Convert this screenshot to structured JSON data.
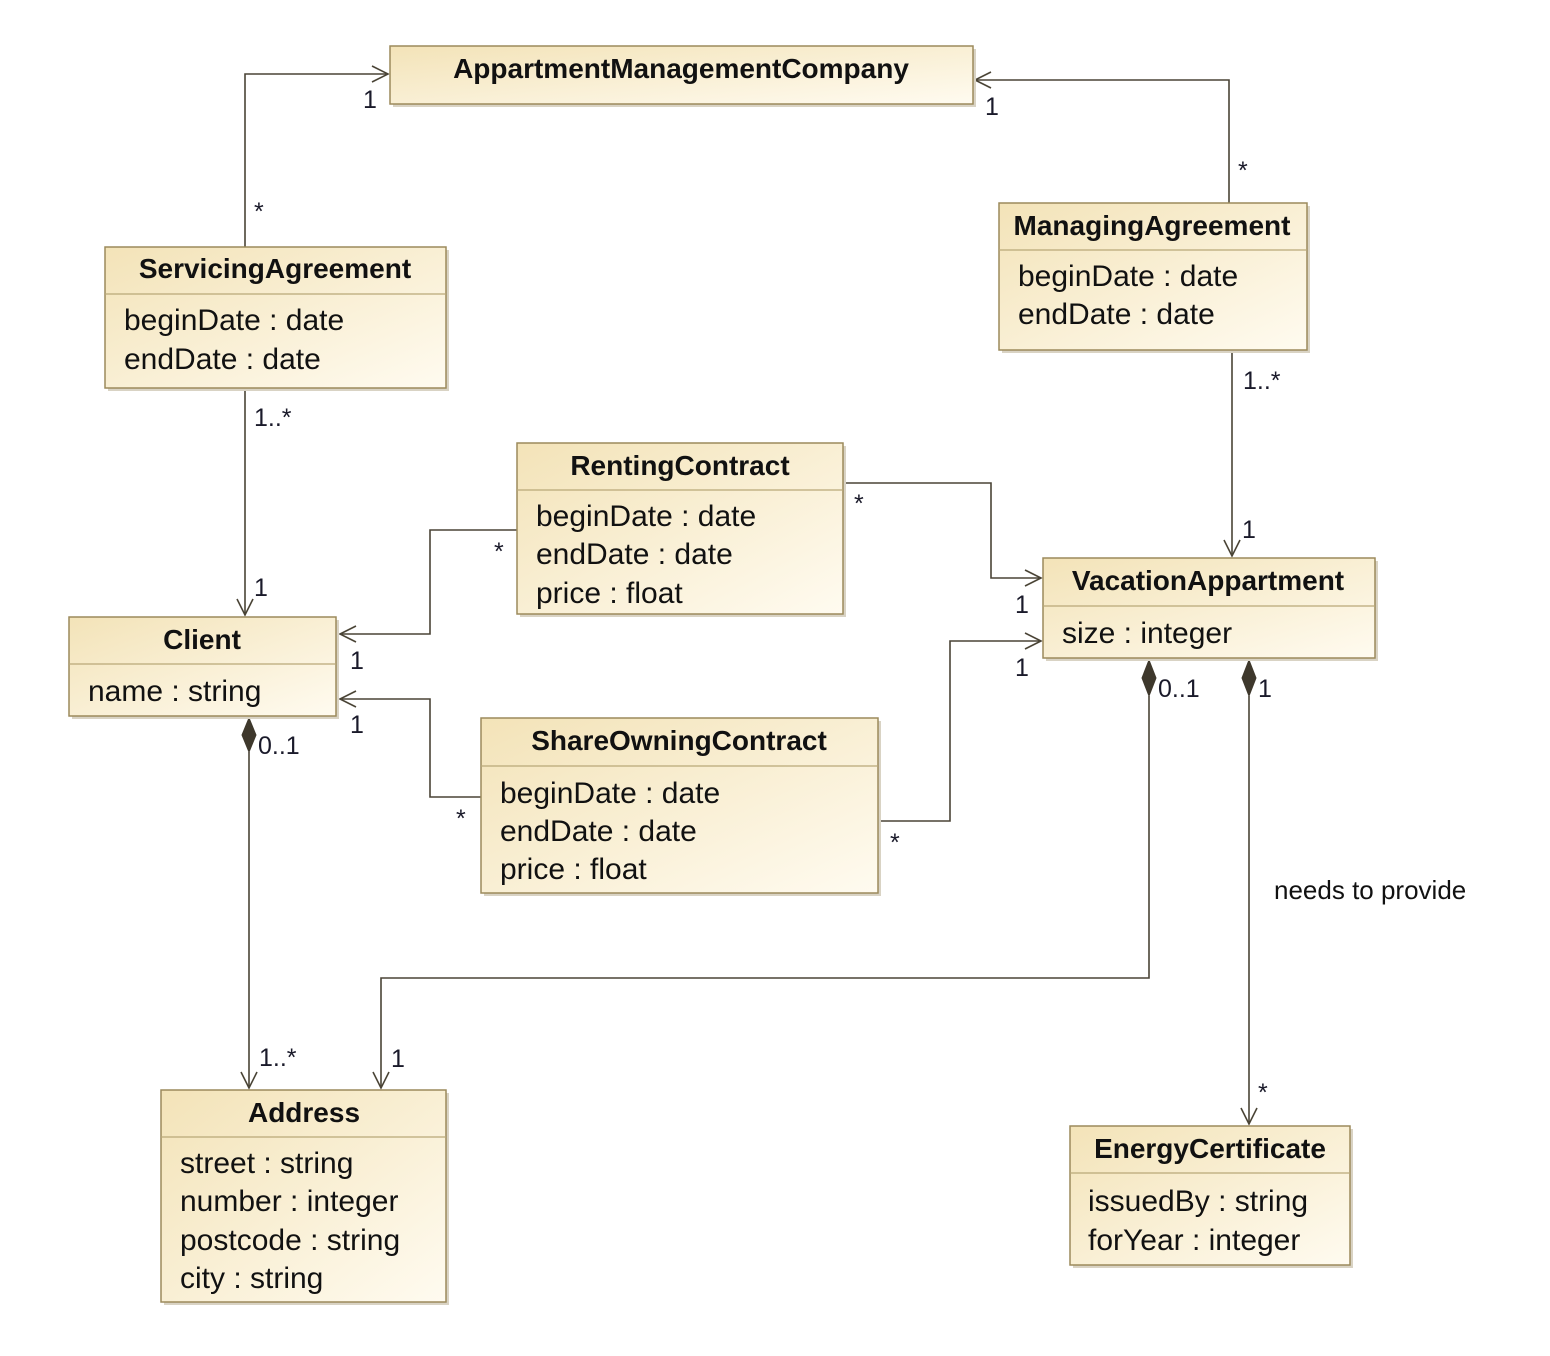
{
  "classes": {
    "amc": {
      "name": "AppartmentManagementCompany",
      "attributes": []
    },
    "servicing": {
      "name": "ServicingAgreement",
      "attributes": [
        "beginDate : date",
        "endDate : date"
      ]
    },
    "managing": {
      "name": "ManagingAgreement",
      "attributes": [
        "beginDate : date",
        "endDate : date"
      ]
    },
    "renting": {
      "name": "RentingContract",
      "attributes": [
        "beginDate : date",
        "endDate : date",
        "price : float"
      ]
    },
    "vacation": {
      "name": "VacationAppartment",
      "attributes": [
        "size : integer"
      ]
    },
    "client": {
      "name": "Client",
      "attributes": [
        "name : string"
      ]
    },
    "share": {
      "name": "ShareOwningContract",
      "attributes": [
        "beginDate : date",
        "endDate : date",
        "price : float"
      ]
    },
    "address": {
      "name": "Address",
      "attributes": [
        "street : string",
        "number : integer",
        "postcode : string",
        "city : string"
      ]
    },
    "energy": {
      "name": "EnergyCertificate",
      "attributes": [
        "issuedBy : string",
        "forYear : integer"
      ]
    }
  },
  "associations": {
    "servicing_amc": {
      "source": "*",
      "target": "1"
    },
    "managing_amc": {
      "source": "*",
      "target": "1"
    },
    "servicing_client": {
      "source": "1..*",
      "target": "1"
    },
    "managing_vacation": {
      "source": "1..*",
      "target": "1"
    },
    "renting_client": {
      "source": "*",
      "target": "1"
    },
    "renting_vacation": {
      "source": "*",
      "target": "1"
    },
    "share_client": {
      "source": "*",
      "target": "1"
    },
    "share_vacation": {
      "source": "*",
      "target": "1"
    },
    "client_address": {
      "source": "0..1",
      "target": "1..*",
      "kind": "composition"
    },
    "vacation_address": {
      "source": "0..1",
      "target": "1",
      "kind": "composition"
    },
    "vacation_energy": {
      "source": "1",
      "target": "*",
      "kind": "composition",
      "label": "needs to provide"
    }
  },
  "colors": {
    "box_fill_top": "#f3e3b8",
    "box_fill_bottom": "#fffbf0",
    "border": "#9c8a5c",
    "line": "#4a4436"
  }
}
